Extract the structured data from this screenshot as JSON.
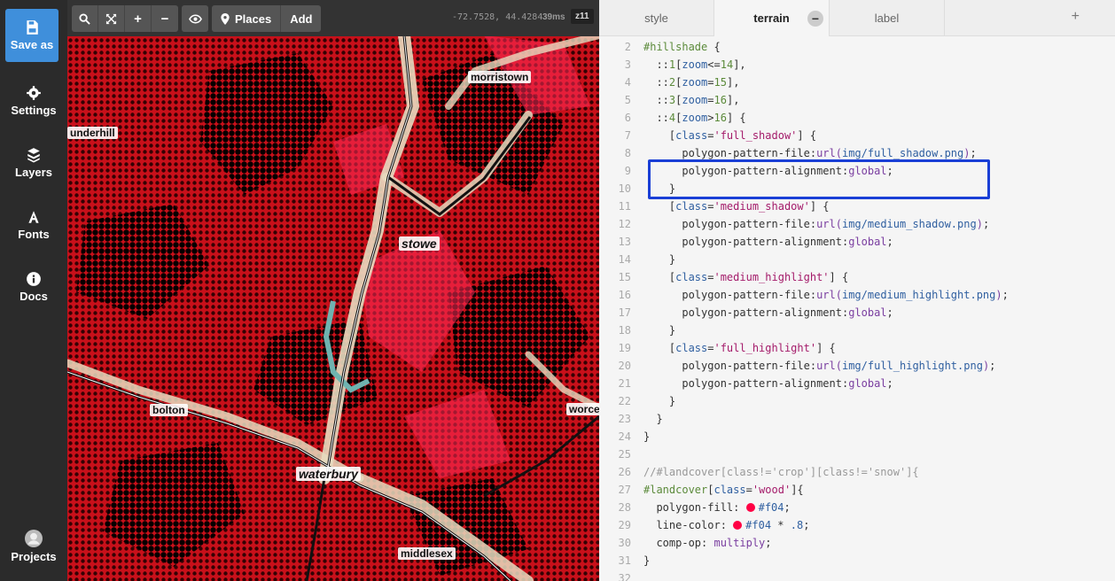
{
  "sidebar": {
    "items": [
      {
        "label": "Save as",
        "icon": "save-icon"
      },
      {
        "label": "Settings",
        "icon": "gear-icon"
      },
      {
        "label": "Layers",
        "icon": "layers-icon"
      },
      {
        "label": "Fonts",
        "icon": "font-icon"
      },
      {
        "label": "Docs",
        "icon": "info-icon"
      },
      {
        "label": "Projects",
        "icon": "user-icon"
      }
    ]
  },
  "toolbar": {
    "places_label": "Places",
    "add_label": "Add",
    "coords": "-72.7528, 44.4284",
    "render_time": "39ms",
    "zoom": "z11"
  },
  "map": {
    "labels": {
      "morristown": "morristown",
      "underhill": "underhill",
      "stowe": "stowe",
      "bolton": "bolton",
      "worcester": "worce",
      "waterbury": "waterbury",
      "middlesex": "middlesex"
    }
  },
  "tabs": [
    {
      "label": "style",
      "active": false
    },
    {
      "label": "terrain",
      "active": true
    },
    {
      "label": "label",
      "active": false
    }
  ],
  "tab_add": "+",
  "tab_minus": "−",
  "colors": {
    "accent": "#3f8fdb",
    "highlight_box": "#1a3fd6",
    "wood_fill": "#f04"
  }
}
